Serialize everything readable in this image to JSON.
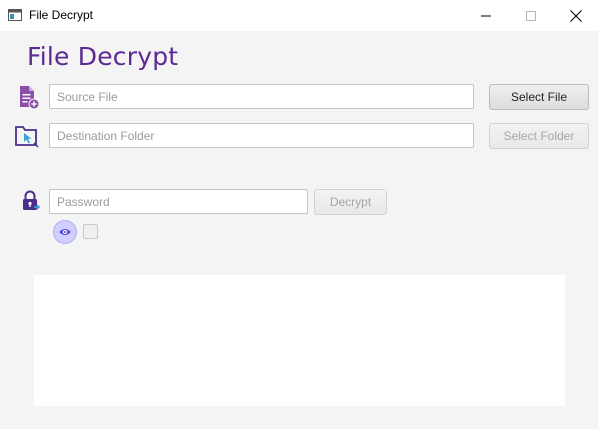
{
  "window": {
    "title": "File Decrypt",
    "minimize_icon": "minimize-icon",
    "maximize_icon": "maximize-icon",
    "close_icon": "close-icon"
  },
  "header": {
    "title": "File Decrypt"
  },
  "source": {
    "icon": "file-add-icon",
    "placeholder": "Source File",
    "value": "",
    "button_label": "Select File"
  },
  "destination": {
    "icon": "folder-select-icon",
    "placeholder": "Destination Folder",
    "value": "",
    "button_label": "Select Folder"
  },
  "password": {
    "icon": "lock-icon",
    "placeholder": "Password",
    "value": "",
    "button_label": "Decrypt",
    "show_toggle_icon": "eye-icon",
    "show_checked": false
  },
  "output": {
    "text": ""
  },
  "colors": {
    "accent": "#5b2a93",
    "icon_purple": "#8a4fa8",
    "toggle": "#cfd0ff"
  }
}
